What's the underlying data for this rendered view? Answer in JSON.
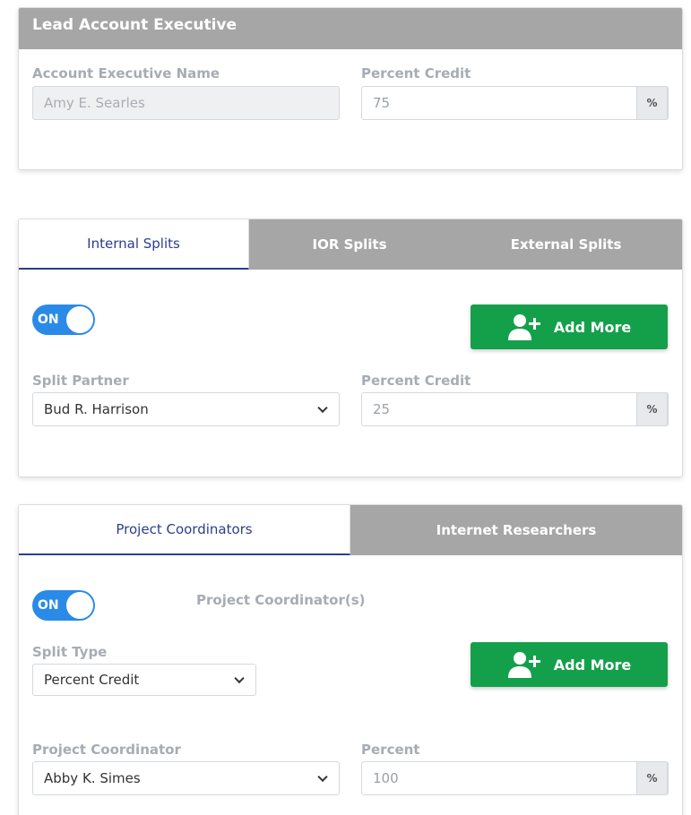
{
  "lead": {
    "header": "Lead Account Executive",
    "name_label": "Account Executive Name",
    "name_value": "Amy E. Searles",
    "percent_label": "Percent Credit",
    "percent_value": "75",
    "percent_addon": "%"
  },
  "splits": {
    "tabs": [
      "Internal Splits",
      "IOR Splits",
      "External Splits"
    ],
    "active_tab": 0,
    "toggle_label": "ON",
    "add_more_label": "Add More",
    "partner_label": "Split Partner",
    "partner_value": "Bud R. Harrison",
    "percent_label": "Percent Credit",
    "percent_value": "25",
    "percent_addon": "%"
  },
  "coordinators": {
    "tabs": [
      "Project Coordinators",
      "Internet Researchers"
    ],
    "active_tab": 0,
    "toggle_label": "ON",
    "section_label": "Project Coordinator(s)",
    "split_type_label": "Split Type",
    "split_type_value": "Percent Credit",
    "add_more_label": "Add More",
    "coordinator_label": "Project Coordinator",
    "coordinator_value": "Abby K. Simes",
    "percent_label": "Percent",
    "percent_value": "100",
    "percent_addon": "%"
  },
  "colors": {
    "header_gray": "#a6a6a6",
    "active_tab_blue": "#2c3e8c",
    "toggle_blue": "#2a8ae8",
    "add_green": "#14a04b"
  },
  "icons": [
    "user-plus-icon",
    "chevron-down-icon"
  ]
}
